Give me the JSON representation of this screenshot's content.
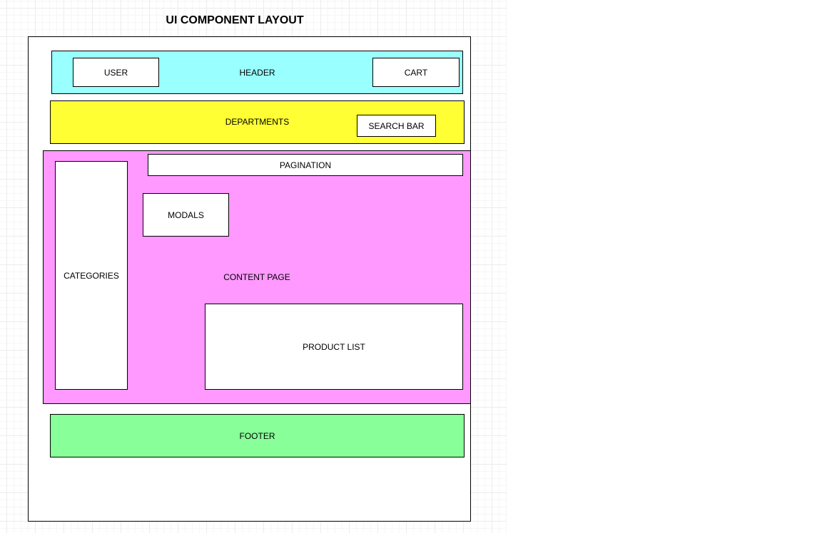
{
  "title": "UI COMPONENT LAYOUT",
  "colors": {
    "header": "#99ffff",
    "departments": "#ffff33",
    "content": "#ff99ff",
    "footer": "#88ff99",
    "box": "#ffffff",
    "stroke": "#000000"
  },
  "header": {
    "label": "HEADER",
    "user": "USER",
    "cart": "CART"
  },
  "departments": {
    "label": "DEPARTMENTS",
    "search_bar": "SEARCH BAR"
  },
  "content": {
    "label": "CONTENT PAGE",
    "pagination": "PAGINATION",
    "modals": "MODALS",
    "categories": "CATEGORIES",
    "product_list": "PRODUCT LIST"
  },
  "footer": {
    "label": "FOOTER"
  }
}
